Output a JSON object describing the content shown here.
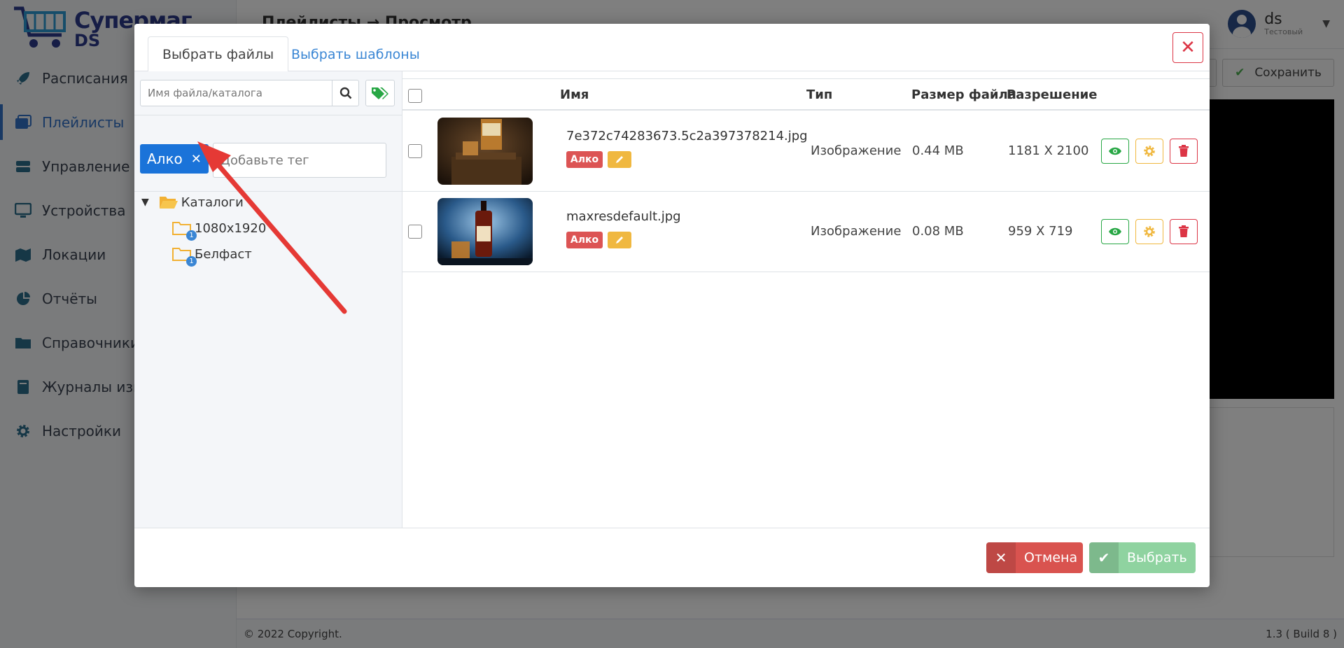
{
  "app": {
    "logo_line1": "Супермаг",
    "logo_line2": "DS",
    "breadcrumb": "Плейлисты → Просмотр",
    "user_name": "ds",
    "user_role": "Тестовый",
    "save_label": "Сохранить",
    "footer_left": "© 2022 Copyright.",
    "footer_right": "1.3 ( Build 8 )"
  },
  "sidebar": {
    "items": [
      {
        "label": "Расписания",
        "icon": "rocket-icon",
        "active": false
      },
      {
        "label": "Плейлисты",
        "icon": "images-icon",
        "active": true
      },
      {
        "label": "Управление ко",
        "icon": "server-icon",
        "active": false
      },
      {
        "label": "Устройства",
        "icon": "monitor-icon",
        "active": false
      },
      {
        "label": "Локации",
        "icon": "map-icon",
        "active": false
      },
      {
        "label": "Отчёты",
        "icon": "pie-chart-icon",
        "active": false
      },
      {
        "label": "Справочники",
        "icon": "folder-icon",
        "active": false
      },
      {
        "label": "Журналы изме",
        "icon": "book-icon",
        "active": false
      },
      {
        "label": "Настройки",
        "icon": "gear-icon",
        "active": false
      }
    ]
  },
  "modal": {
    "tabs": [
      {
        "label": "Выбрать файлы",
        "active": true
      },
      {
        "label": "Выбрать шаблоны",
        "active": false
      }
    ],
    "search_placeholder": "Имя файла/каталога",
    "tag_chip": "Алко",
    "tag_placeholder": "Добавьте тег",
    "tree": {
      "root": "Каталоги",
      "children": [
        {
          "label": "1080x1920",
          "badge": "1"
        },
        {
          "label": "Белфаст",
          "badge": "1"
        }
      ]
    },
    "table": {
      "headers": {
        "name": "Имя",
        "type": "Тип",
        "size": "Размер файла",
        "resolution": "Разрешение"
      },
      "rows": [
        {
          "name": "7e372c74283673.5c2a397378214.jpg",
          "tag": "Алко",
          "type": "Изображение",
          "size": "0.44 MB",
          "resolution": "1181 X 2100"
        },
        {
          "name": "maxresdefault.jpg",
          "tag": "Алко",
          "type": "Изображение",
          "size": "0.08 MB",
          "resolution": "959 X 719"
        }
      ]
    },
    "cancel_label": "Отмена",
    "select_label": "Выбрать"
  },
  "colors": {
    "primary": "#1a73d9",
    "link": "#3a86d4",
    "danger": "#dc3545",
    "warning": "#f0b840",
    "success": "#28a745",
    "arrow": "#e53935"
  }
}
